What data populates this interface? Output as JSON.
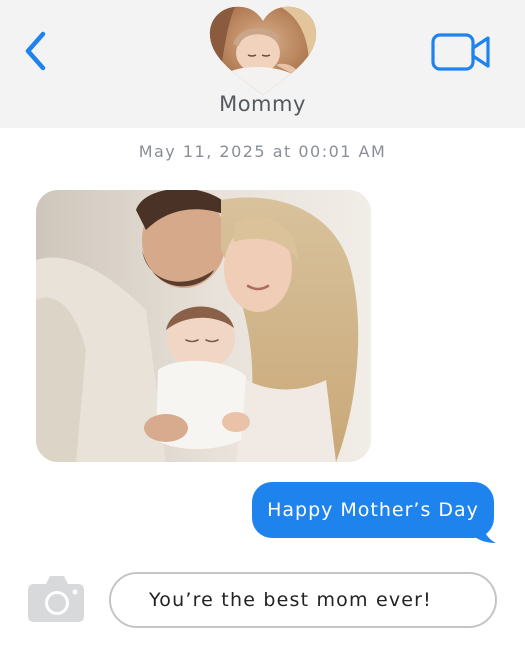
{
  "header": {
    "back_icon": "chevron-left-icon",
    "contact_name": "Mommy",
    "avatar_shape": "heart",
    "video_icon": "video-camera-icon"
  },
  "conversation": {
    "timestamp": "May 11, 2025 at  00:01 AM",
    "photo": "family-photo-father-mother-newborn",
    "sent_message": "Happy Mother’s Day"
  },
  "composer": {
    "camera_icon": "camera-icon",
    "draft_text": "You’re the best mom ever!"
  },
  "colors": {
    "accent": "#1f83ee",
    "header_bg": "#f3f3f4",
    "icon_gray": "#d8d9db"
  }
}
